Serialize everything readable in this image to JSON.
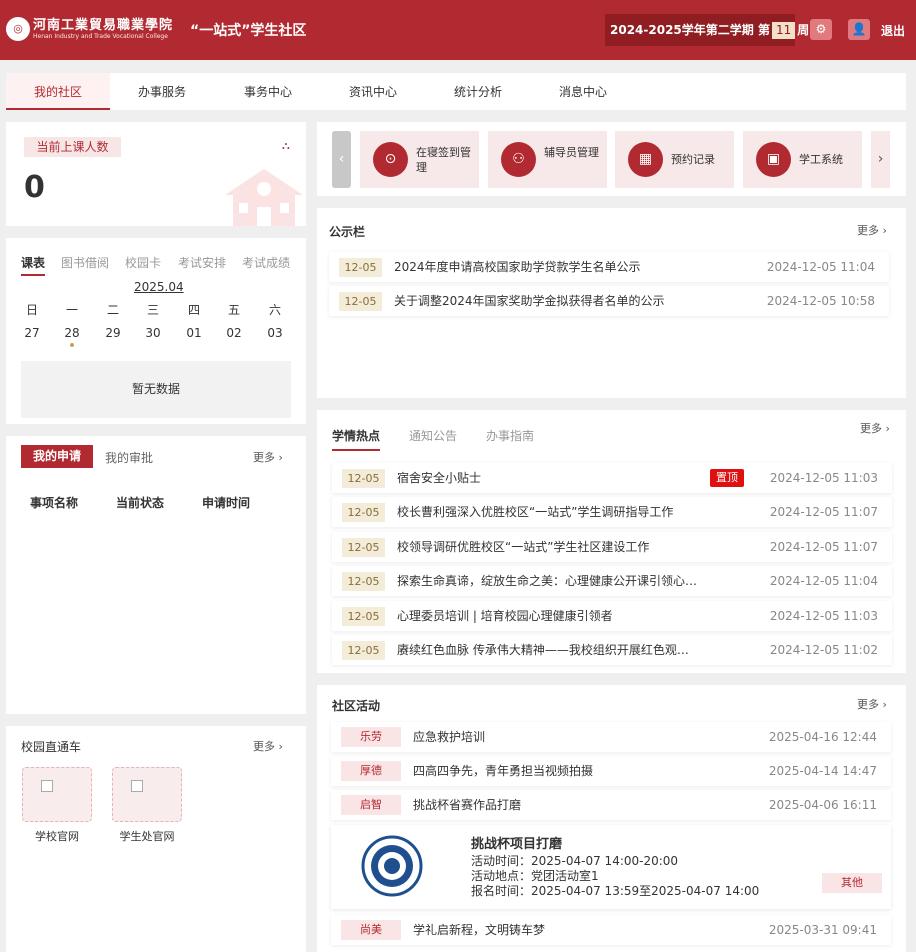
{
  "header": {
    "school_cn": "河南工業貿易職業學院",
    "school_en": "Henan Industry and Trade Vocational College",
    "site_title": "“一站式”学生社区",
    "term_text": "2024-2025学年第二学期 第",
    "week": "11",
    "week_suffix": "周",
    "logout": "退出",
    "settings_icon": "gear-icon",
    "user_icon": "user-icon"
  },
  "nav": {
    "items": [
      {
        "label": "我的社区",
        "active": true
      },
      {
        "label": "办事服务"
      },
      {
        "label": "事务中心"
      },
      {
        "label": "资讯中心"
      },
      {
        "label": "统计分析"
      },
      {
        "label": "消息中心"
      }
    ]
  },
  "attendance": {
    "label": "当前上课人数",
    "value": "0"
  },
  "schedule": {
    "tabs": [
      "课表",
      "图书借阅",
      "校园卡",
      "考试安排",
      "考试成绩"
    ],
    "month": "2025.04",
    "weekdays": [
      "日",
      "一",
      "二",
      "三",
      "四",
      "五",
      "六"
    ],
    "days": [
      "27",
      "28",
      "29",
      "30",
      "01",
      "02",
      "03"
    ],
    "empty": "暂无数据"
  },
  "applications": {
    "tabs": [
      "我的申请",
      "我的审批"
    ],
    "more": "更多",
    "columns": [
      "事项名称",
      "当前状态",
      "申请时间"
    ]
  },
  "campus_links": {
    "title": "校园直通车",
    "more": "更多",
    "items": [
      "学校官网",
      "学生处官网"
    ]
  },
  "quick_links": [
    {
      "label": "在寝签到管理",
      "icon": "sign-in-icon"
    },
    {
      "label": "辅导员管理",
      "icon": "people-icon"
    },
    {
      "label": "预约记录",
      "icon": "calendar-icon"
    },
    {
      "label": "学工系统",
      "icon": "book-icon"
    }
  ],
  "notice_board": {
    "title": "公示栏",
    "more": "更多",
    "items": [
      {
        "date": "12-05",
        "title": "2024年度申请高校国家助学贷款学生名单公示",
        "time": "2024-12-05 11:04"
      },
      {
        "date": "12-05",
        "title": "关于调整2024年国家奖助学金拟获得者名单的公示",
        "time": "2024-12-05 10:58"
      }
    ]
  },
  "news": {
    "tabs": [
      "学情热点",
      "通知公告",
      "办事指南"
    ],
    "more": "更多",
    "pin_label": "置顶",
    "items": [
      {
        "date": "12-05",
        "title": "宿舍安全小贴士",
        "time": "2024-12-05 11:03",
        "pinned": true
      },
      {
        "date": "12-05",
        "title": "校长曹利强深入优胜校区“一站式”学生调研指导工作",
        "time": "2024-12-05 11:07"
      },
      {
        "date": "12-05",
        "title": "校领导调研优胜校区“一站式”学生社区建设工作",
        "time": "2024-12-05 11:07"
      },
      {
        "date": "12-05",
        "title": "探索生命真谛，绽放生命之美：心理健康公开课引领心…",
        "time": "2024-12-05 11:04"
      },
      {
        "date": "12-05",
        "title": "心理委员培训 | 培育校园心理健康引领者",
        "time": "2024-12-05 11:03"
      },
      {
        "date": "12-05",
        "title": "赓续红色血脉 传承伟大精神——我校组织开展红色观…",
        "time": "2024-12-05 11:02"
      }
    ]
  },
  "activities": {
    "title": "社区活动",
    "more": "更多",
    "items": [
      {
        "tag": "乐劳",
        "title": "应急救护培训",
        "time": "2025-04-16 12:44"
      },
      {
        "tag": "厚德",
        "title": "四高四争先，青年勇担当视频拍摄",
        "time": "2025-04-14 14:47"
      },
      {
        "tag": "启智",
        "title": "挑战杯省赛作品打磨",
        "time": "2025-04-06 16:11"
      },
      {
        "tag": "尚美",
        "title": "学礼启新程，文明铸车梦",
        "time": "2025-03-31 09:41"
      }
    ],
    "detail": {
      "title": "挑战杯项目打磨",
      "time_line": "活动时间：2025-04-07 14:00-20:00",
      "place_line": "活动地点：党团活动室1",
      "signup_line": "报名时间：2025-04-07 13:59至2025-04-07 14:00",
      "category": "其他"
    }
  }
}
